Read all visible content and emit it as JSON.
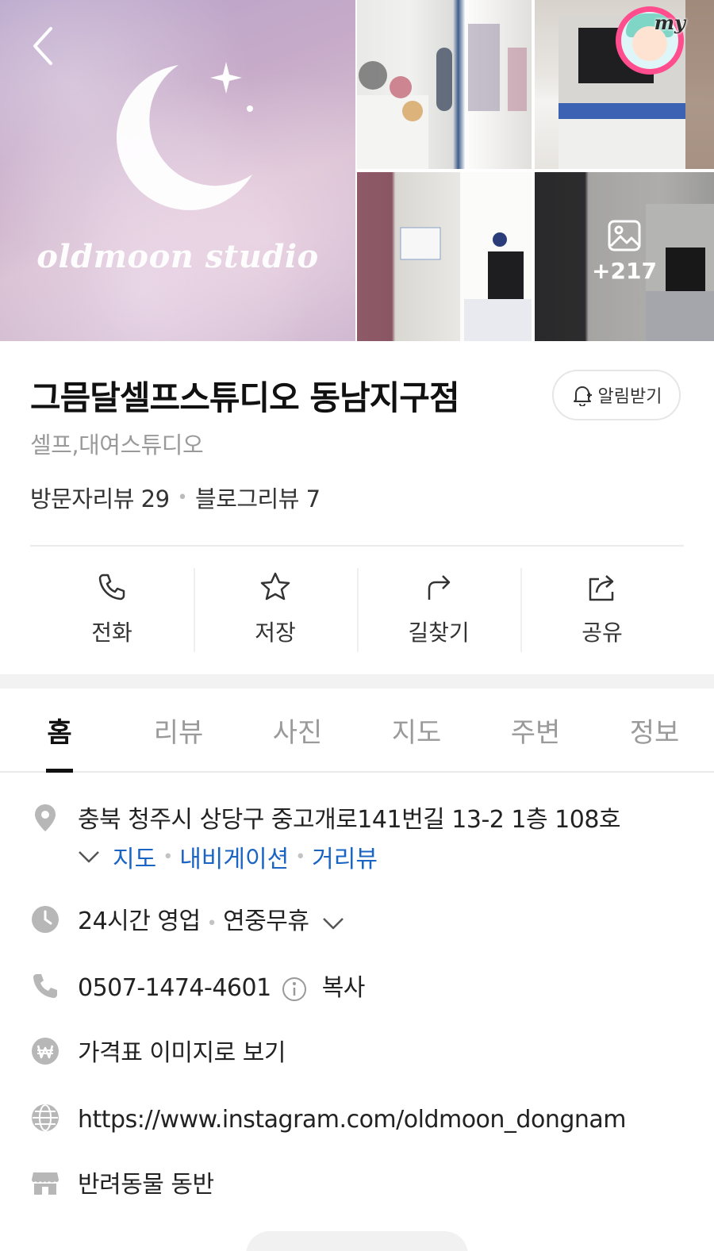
{
  "gallery": {
    "brand_text": "oldmoon studio",
    "photo_count": "+217"
  },
  "my_badge": {
    "label": "my"
  },
  "place": {
    "title": "그믐달셀프스튜디오 동남지구점",
    "category": "셀프,대여스튜디오",
    "visitor_reviews": "방문자리뷰 29",
    "blog_reviews": "블로그리뷰 7",
    "notify_label": "알림받기"
  },
  "actions": {
    "call": "전화",
    "save": "저장",
    "directions": "길찾기",
    "share": "공유"
  },
  "tabs": [
    "홈",
    "리뷰",
    "사진",
    "지도",
    "주변",
    "정보"
  ],
  "info": {
    "address": "충북 청주시 상당구 중고개로141번길 13-2 1층 108호",
    "address_links": {
      "map": "지도",
      "navigation": "내비게이션",
      "street_view": "거리뷰"
    },
    "hours": "24시간 영업",
    "hours_note": "연중무휴",
    "phone": "0507-1474-4601",
    "copy_label": "복사",
    "price_link": "가격표 이미지로 보기",
    "website": "https://www.instagram.com/oldmoon_dongnam",
    "pet": "반려동물 동반"
  },
  "colors": {
    "link": "#1a64c4",
    "text": "#222222",
    "muted": "#9a9a9a",
    "badge": "#ff4d8d"
  }
}
